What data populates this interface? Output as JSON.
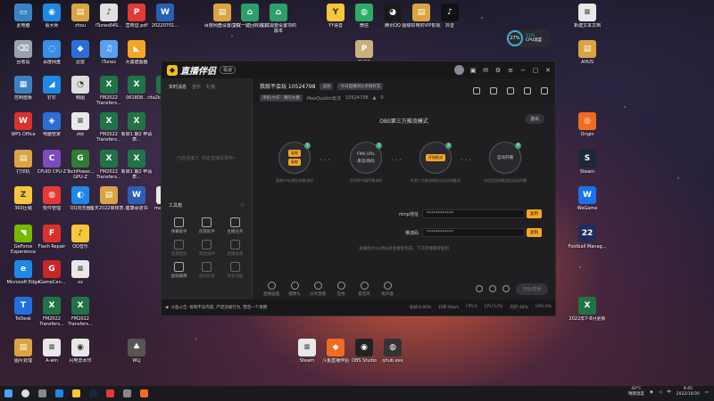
{
  "desktop": {
    "icons": [
      {
        "label": "此电脑",
        "x": 0,
        "y": 0,
        "color": "#3b82c4",
        "glyph": "▭"
      },
      {
        "label": "看大师",
        "x": 1,
        "y": 0,
        "color": "#1e88e5",
        "glyph": "◉"
      },
      {
        "label": "zhou",
        "x": 2,
        "y": 0,
        "color": "#d9a441",
        "glyph": "▤"
      },
      {
        "label": "iTunes64S...",
        "x": 3,
        "y": 0,
        "color": "#e0e0e0",
        "glyph": "♪"
      },
      {
        "label": "营商证.pdf",
        "x": 4,
        "y": 0,
        "color": "#e53935",
        "glyph": "P"
      },
      {
        "label": "20220701...",
        "x": 5,
        "y": 0,
        "color": "#2b5fb4",
        "glyph": "W"
      },
      {
        "label": "百度网盘设置(26)",
        "x": 6,
        "y": 0,
        "color": "#d9a441",
        "glyph": "▤"
      },
      {
        "label": "生成一键回收版本",
        "x": 7,
        "y": 0,
        "color": "#2e9e6b",
        "glyph": "⌂"
      },
      {
        "label": "生成需要设置项的版本",
        "x": 8,
        "y": 0,
        "color": "#2e9e6b",
        "glyph": "⌂"
      },
      {
        "label": "YY语音",
        "x": 10,
        "y": 0,
        "color": "#f7c63b",
        "glyph": "Y"
      },
      {
        "label": "微信",
        "x": 11,
        "y": 0,
        "color": "#2aae67",
        "glyph": "◍"
      },
      {
        "label": "腾讯QQ",
        "x": 12,
        "y": 0,
        "color": "#1a1a1a",
        "glyph": "◕"
      },
      {
        "label": "超级好用的VIP影视",
        "x": 13,
        "y": 0,
        "color": "#d9a441",
        "glyph": "▤"
      },
      {
        "label": "抖音",
        "x": 14,
        "y": 0,
        "color": "#111111",
        "glyph": "♪"
      },
      {
        "label": "新建文本文档",
        "x": 16,
        "y": 0,
        "color": "#e8e8e8",
        "glyph": "≡"
      },
      {
        "label": "回收站",
        "x": 0,
        "y": 1,
        "color": "#9aa3ad",
        "glyph": "⌫"
      },
      {
        "label": "百度网盘",
        "x": 1,
        "y": 1,
        "color": "#3a8ee6",
        "glyph": "◌"
      },
      {
        "label": "迅雷",
        "x": 2,
        "y": 1,
        "color": "#2a6fd6",
        "glyph": "◆"
      },
      {
        "label": "iTunes",
        "x": 3,
        "y": 1,
        "color": "#5aa0f0",
        "glyph": "♫"
      },
      {
        "label": "大疆建图器",
        "x": 4,
        "y": 1,
        "color": "#f5a623",
        "glyph": "◣"
      },
      {
        "label": "PUBG",
        "x": 11,
        "y": 1,
        "color": "#c9b27a",
        "glyph": "P"
      },
      {
        "label": "AHUS",
        "x": 16,
        "y": 1,
        "color": "#d9a441",
        "glyph": "▤"
      },
      {
        "label": "控制面板",
        "x": 0,
        "y": 2,
        "color": "#3b82c4",
        "glyph": "▦"
      },
      {
        "label": "钉钉",
        "x": 1,
        "y": 2,
        "color": "#1e88e5",
        "glyph": "◢"
      },
      {
        "label": "韩图",
        "x": 2,
        "y": 2,
        "color": "#dddddd",
        "glyph": "◔"
      },
      {
        "label": "FM2022 Transfers...",
        "x": 3,
        "y": 2,
        "color": "#217346",
        "glyph": "X"
      },
      {
        "label": "061808...",
        "x": 4,
        "y": 2,
        "color": "#217346",
        "glyph": "X"
      },
      {
        "label": "rita2k2 速率设置",
        "x": 5,
        "y": 2,
        "color": "#217346",
        "glyph": "X"
      },
      {
        "label": "WPS Office",
        "x": 0,
        "y": 3,
        "color": "#d8322b",
        "glyph": "W"
      },
      {
        "label": "电脑管家",
        "x": 1,
        "y": 3,
        "color": "#2a6fd6",
        "glyph": "◈"
      },
      {
        "label": "zkk",
        "x": 2,
        "y": 3,
        "color": "#e8e8e8",
        "glyph": "≡"
      },
      {
        "label": "FM2022 Transfers...",
        "x": 3,
        "y": 3,
        "color": "#217346",
        "glyph": "X"
      },
      {
        "label": "新转1 期2 申请表...",
        "x": 4,
        "y": 3,
        "color": "#217346",
        "glyph": "X"
      },
      {
        "label": "Origin",
        "x": 16,
        "y": 3,
        "color": "#f06c22",
        "glyph": "◎"
      },
      {
        "label": "打印机",
        "x": 0,
        "y": 4,
        "color": "#d9a441",
        "glyph": "▤"
      },
      {
        "label": "CPUID CPU-Z",
        "x": 1,
        "y": 4,
        "color": "#7c4dbd",
        "glyph": "C"
      },
      {
        "label": "TechPower... GPU-Z",
        "x": 2,
        "y": 4,
        "color": "#2e7d32",
        "glyph": "G"
      },
      {
        "label": "FM2022 Transfers...",
        "x": 3,
        "y": 4,
        "color": "#217346",
        "glyph": "X"
      },
      {
        "label": "新转1 期2 申请表...",
        "x": 4,
        "y": 4,
        "color": "#217346",
        "glyph": "X"
      },
      {
        "label": "Steam",
        "x": 16,
        "y": 4,
        "color": "#1b2838",
        "glyph": "S"
      },
      {
        "label": "360压缩",
        "x": 0,
        "y": 5,
        "color": "#f7c63b",
        "glyph": "Z"
      },
      {
        "label": "软件管理",
        "x": 1,
        "y": 5,
        "color": "#e53935",
        "glyph": "◍"
      },
      {
        "label": "QQ浏览器",
        "x": 2,
        "y": 5,
        "color": "#1e88e5",
        "glyph": "◐"
      },
      {
        "label": "备天2022审核表...",
        "x": 3,
        "y": 5,
        "color": "#d9a441",
        "glyph": "▤"
      },
      {
        "label": "健康承诺书",
        "x": 4,
        "y": 5,
        "color": "#2b5fb4",
        "glyph": "W"
      },
      {
        "label": "macbuy...",
        "x": 5,
        "y": 5,
        "color": "#e8e8e8",
        "glyph": "≡"
      },
      {
        "label": "WeGame",
        "x": 16,
        "y": 5,
        "color": "#1a73e8",
        "glyph": "W"
      },
      {
        "label": "GeForce Experience",
        "x": 0,
        "y": 6,
        "color": "#76b900",
        "glyph": "◥"
      },
      {
        "label": "Flash Repair",
        "x": 1,
        "y": 6,
        "color": "#d8322b",
        "glyph": "F"
      },
      {
        "label": "QQ音乐",
        "x": 2,
        "y": 6,
        "color": "#f7c63b",
        "glyph": "♪"
      },
      {
        "label": "Football Manag...",
        "x": 16,
        "y": 6,
        "color": "#1f2d5c",
        "glyph": "22"
      },
      {
        "label": "Microsoft Edge",
        "x": 0,
        "y": 7,
        "color": "#1e88e5",
        "glyph": "e"
      },
      {
        "label": "iGameCen...",
        "x": 1,
        "y": 7,
        "color": "#c62828",
        "glyph": "G"
      },
      {
        "label": "xx",
        "x": 2,
        "y": 7,
        "color": "#e8e8e8",
        "glyph": "≡"
      },
      {
        "label": "ToDesk",
        "x": 0,
        "y": 8,
        "color": "#1e6fe0",
        "glyph": "T"
      },
      {
        "label": "FM2022 Transfers...",
        "x": 1,
        "y": 8,
        "color": "#217346",
        "glyph": "X"
      },
      {
        "label": "FM2022 Transfers...",
        "x": 2,
        "y": 8,
        "color": "#217346",
        "glyph": "X"
      },
      {
        "label": "2022年7-8月更新",
        "x": 16,
        "y": 8,
        "color": "#217346",
        "glyph": "X"
      },
      {
        "label": "图片处理",
        "x": 0,
        "y": 9,
        "color": "#d9a441",
        "glyph": "▤"
      },
      {
        "label": "A-win",
        "x": 1,
        "y": 9,
        "color": "#e8e8e8",
        "glyph": "≡"
      },
      {
        "label": "闪电去水印",
        "x": 2,
        "y": 9,
        "color": "#e8e8e8",
        "glyph": "◉"
      },
      {
        "label": "WLJ",
        "x": 4,
        "y": 9,
        "color": "#555555",
        "glyph": "♣"
      },
      {
        "label": "Steam",
        "x": 9,
        "y": 9,
        "color": "#e8e8e8",
        "glyph": "≡"
      },
      {
        "label": "斗鱼直播伴侣",
        "x": 10,
        "y": 9,
        "color": "#f06c22",
        "glyph": "◆"
      },
      {
        "label": "OBS Studio",
        "x": 11,
        "y": 9,
        "color": "#222222",
        "glyph": "◉"
      },
      {
        "label": "qhub.exe",
        "x": 12,
        "y": 9,
        "color": "#333333",
        "glyph": "◍"
      }
    ]
  },
  "cpu_widget": {
    "percent": "27%",
    "temp": "11%",
    "label": "CPU温度"
  },
  "app": {
    "name": "直播伴侣",
    "version": "极速",
    "left_tabs": [
      "实时消息",
      "音乐",
      "礼物"
    ],
    "chat_empty": "已经连接了, 快去直播看看吧~",
    "toolbox_label": "工具箱",
    "tools": [
      {
        "label": "弹幕助手",
        "dim": false
      },
      {
        "label": "房管助手",
        "dim": false
      },
      {
        "label": "主播任务",
        "dim": false
      },
      {
        "label": "直播回放",
        "dim": true
      },
      {
        "label": "粉丝福利",
        "dim": true
      },
      {
        "label": "直播录像",
        "dim": true
      },
      {
        "label": "虚拟摄像",
        "dim": false
      },
      {
        "label": "虚拟形象",
        "dim": true
      },
      {
        "label": "更多功能",
        "dim": true
      }
    ],
    "room": {
      "title": "我就不会玩 10524798",
      "tag1": "竞技",
      "tag2": "今日直播间分享给好友",
      "category": "单机/大作 · 我的大模",
      "room_label": "MeoQuolim玩法",
      "room_id": "10524798",
      "hot": "0"
    },
    "obs": {
      "title": "OBS第三方推流模式",
      "exit": "退出",
      "steps": [
        {
          "num": "1",
          "btn1": "复制",
          "btn2": "复制",
          "text": "",
          "desc": "复制rtmp地址和推流码"
        },
        {
          "num": "2",
          "btn1": "",
          "btn2": "",
          "text": "FMS URL\n串流/串码",
          "desc": "在OBS中填写推流码"
        },
        {
          "num": "3",
          "btn1": "开始推流",
          "btn2": "",
          "text": "",
          "desc": "在第三方推流软件点击开始推流"
        },
        {
          "num": "4",
          "btn1": "",
          "btn2": "",
          "text": "自动开播",
          "desc": "伴侣检测到推流后自动开播"
        }
      ],
      "rtmp_label": "rtmp地址",
      "rtmp_value": "************",
      "rtmp_btn": "复制",
      "key_label": "推流码",
      "key_value": "************",
      "key_btn": "复制",
      "tip": "关播后rtmp地址将会重新生成，下次开播需要复制"
    },
    "bottom_items": [
      "直播画面",
      "摄像头",
      "分享直播",
      "连线",
      "麦克风",
      "扬声器"
    ],
    "start_btn": "开始直播",
    "status_notice": "斗鱼公告: 抵制不良内容, 严禁违规行为, 营造一个清朗",
    "stats": [
      "丢帧:0.00%",
      "码率:0kb/s",
      "FPS:0",
      "CPU:12%",
      "内存:48%",
      "GPU:0%"
    ]
  },
  "taskbar": {
    "temp": "42°C",
    "weather": "晴朗温度",
    "time": "9:45",
    "date": "2022/10/30",
    "lang": "中"
  }
}
